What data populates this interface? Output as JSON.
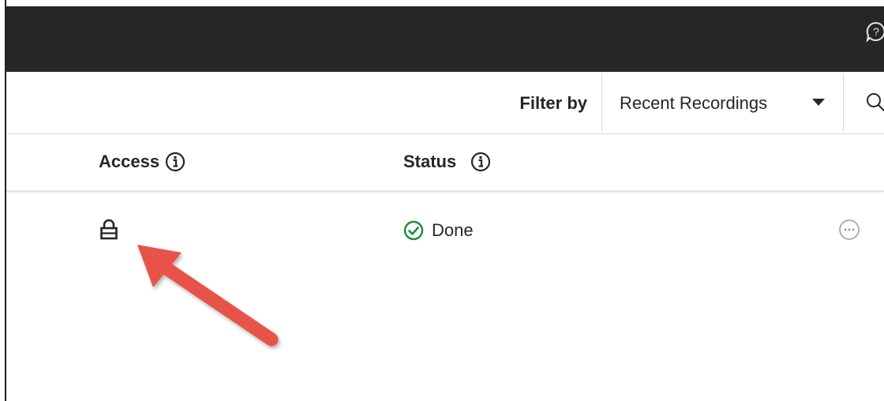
{
  "topbar": {
    "help_icon": "help-chat-icon"
  },
  "filter": {
    "label": "Filter by",
    "selected": "Recent Recordings",
    "caret_icon": "caret-down-icon",
    "search_icon": "search-icon"
  },
  "table": {
    "columns": [
      {
        "label": "Access",
        "icon": "info-icon"
      },
      {
        "label": "Status",
        "icon": "info-icon"
      }
    ],
    "rows": [
      {
        "access_icon": "lock-icon",
        "status": "Done",
        "status_icon": "check-circle-icon",
        "actions_icon": "more-options-icon"
      }
    ]
  },
  "annotation": {
    "arrow_color": "#e8534a"
  },
  "colors": {
    "topbar_bg": "#262626",
    "status_done": "#1e8a3a"
  }
}
